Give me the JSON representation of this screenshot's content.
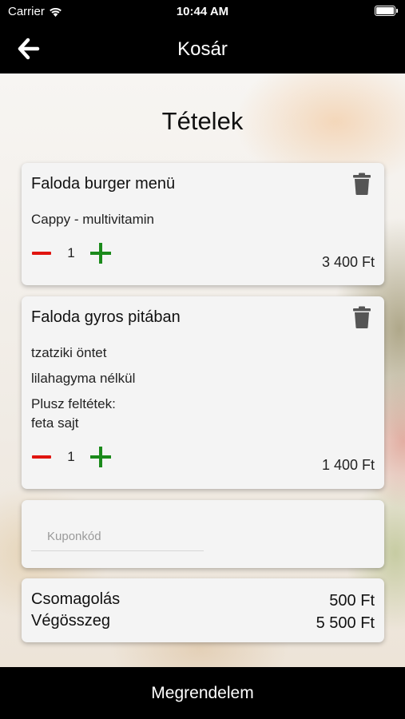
{
  "status_bar": {
    "carrier": "Carrier",
    "time": "10:44 AM"
  },
  "navbar": {
    "title": "Kosár",
    "back_icon": "arrow-left-icon"
  },
  "main": {
    "section_title": "Tételek",
    "items": [
      {
        "name": "Faloda burger menü",
        "details": [
          "Cappy - multivitamin"
        ],
        "quantity": "1",
        "price": "3 400 Ft"
      },
      {
        "name": "Faloda gyros pitában",
        "details": [
          "tzatziki öntet",
          "lilahagyma nélkül",
          "Plusz feltétek:",
          "feta sajt"
        ],
        "quantity": "1",
        "price": "1 400 Ft"
      }
    ],
    "coupon": {
      "placeholder": "Kuponkód",
      "value": ""
    },
    "summary": {
      "packaging_label": "Csomagolás",
      "packaging_value": "500 Ft",
      "total_label": "Végösszeg",
      "total_value": "5 500 Ft"
    }
  },
  "bottom_button": {
    "label": "Megrendelem"
  },
  "colors": {
    "minus": "#e0140f",
    "plus": "#1b8a1b",
    "bar": "#000000"
  }
}
